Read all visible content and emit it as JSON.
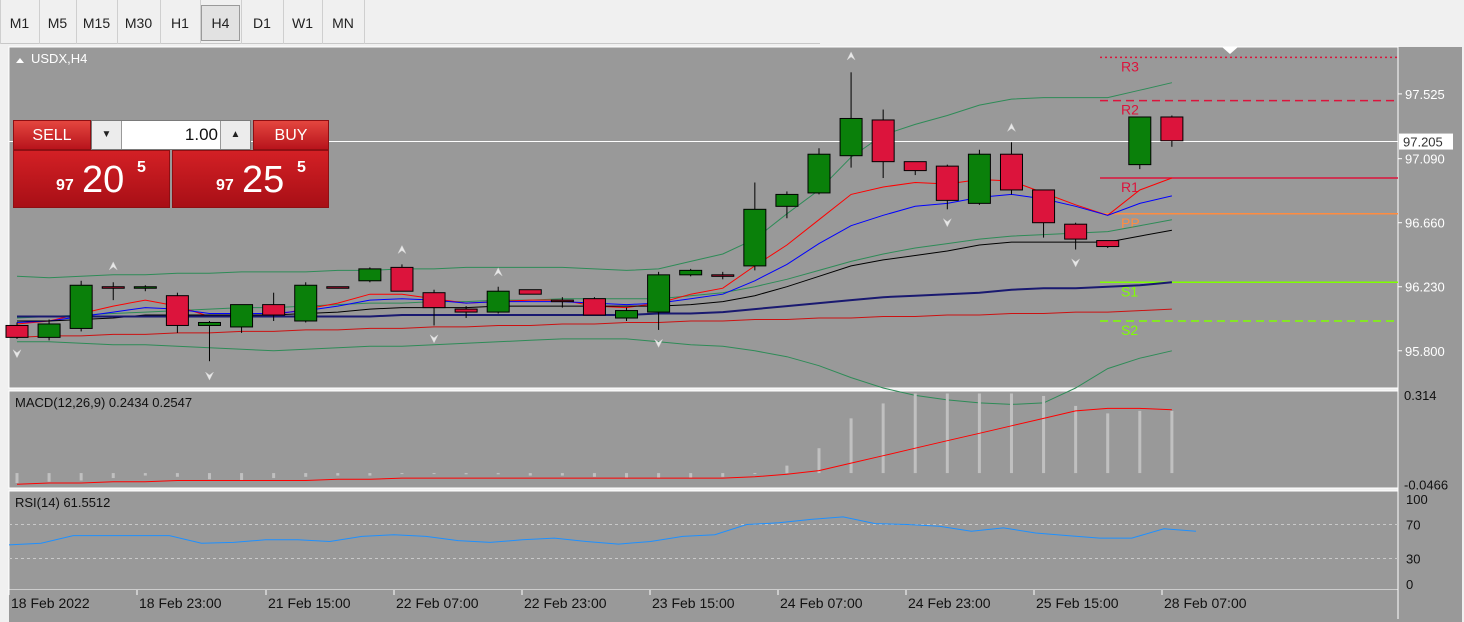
{
  "timeframes": [
    {
      "label": "M1",
      "active": false
    },
    {
      "label": "M5",
      "active": false
    },
    {
      "label": "M15",
      "active": false
    },
    {
      "label": "M30",
      "active": false
    },
    {
      "label": "H1",
      "active": false
    },
    {
      "label": "H4",
      "active": true
    },
    {
      "label": "D1",
      "active": false
    },
    {
      "label": "W1",
      "active": false
    },
    {
      "label": "MN",
      "active": false
    }
  ],
  "symbol_label": "USDX,H4",
  "trade_panel": {
    "sell_label": "SELL",
    "buy_label": "BUY",
    "lot_value": "1.00",
    "sell_price": {
      "prefix": "97",
      "big": "20",
      "sup": "5"
    },
    "buy_price": {
      "prefix": "97",
      "big": "25",
      "sup": "5"
    }
  },
  "colors": {
    "chart_bg": "#999999",
    "bull": "#0a800a",
    "bear": "#dc143c",
    "candle_outline": "#000000",
    "bollinger": "#2e8b57",
    "ma_red": "#ff0000",
    "ma_blue": "#0000ff",
    "ma_black": "#000000",
    "ma_navy": "#191970",
    "ma_long": "#cc1111",
    "rsi_line": "#1e90ff",
    "macd_hist": "#c0c0c0",
    "macd_signal": "#ff0000",
    "r_levels": "#dc143c",
    "pp": "#ff8c40",
    "s_levels": "#7fff00",
    "price_line": "#ffffff"
  },
  "chart_data": [
    {
      "type": "candlestick",
      "title": "USDX,H4",
      "ylim": [
        95.55,
        97.84
      ],
      "y_ticks": [
        "97.525",
        "97.090",
        "96.660",
        "96.230",
        "95.800"
      ],
      "current_price": "97.205",
      "x_labels": [
        "18 Feb 2022",
        "18 Feb 23:00",
        "21 Feb 15:00",
        "22 Feb 07:00",
        "22 Feb 23:00",
        "23 Feb 15:00",
        "24 Feb 07:00",
        "24 Feb 23:00",
        "25 Feb 15:00",
        "28 Feb 07:00"
      ],
      "ohlc": [
        [
          95.97,
          95.99,
          95.88,
          95.89
        ],
        [
          95.89,
          96.01,
          95.87,
          95.98
        ],
        [
          95.95,
          96.27,
          95.93,
          96.24
        ],
        [
          96.23,
          96.26,
          96.14,
          96.22
        ],
        [
          96.22,
          96.24,
          96.2,
          96.23
        ],
        [
          96.17,
          96.19,
          95.92,
          95.97
        ],
        [
          95.97,
          96.0,
          95.73,
          95.99
        ],
        [
          95.96,
          96.11,
          95.92,
          96.11
        ],
        [
          96.11,
          96.19,
          96.0,
          96.04
        ],
        [
          96.0,
          96.26,
          95.99,
          96.24
        ],
        [
          96.23,
          96.23,
          96.22,
          96.22
        ],
        [
          96.27,
          96.36,
          96.26,
          96.35
        ],
        [
          96.36,
          96.38,
          96.23,
          96.2
        ],
        [
          96.19,
          96.21,
          95.97,
          96.09
        ],
        [
          96.08,
          96.1,
          96.02,
          96.06
        ],
        [
          96.06,
          96.23,
          96.05,
          96.2
        ],
        [
          96.21,
          96.21,
          96.18,
          96.18
        ],
        [
          96.14,
          96.16,
          96.09,
          96.13
        ],
        [
          96.15,
          96.16,
          96.07,
          96.04
        ],
        [
          96.02,
          96.09,
          96.0,
          96.07
        ],
        [
          96.06,
          96.33,
          95.94,
          96.31
        ],
        [
          96.31,
          96.35,
          96.3,
          96.34
        ],
        [
          96.31,
          96.33,
          96.28,
          96.3
        ],
        [
          96.37,
          96.93,
          96.34,
          96.75
        ],
        [
          96.77,
          96.87,
          96.69,
          96.85
        ],
        [
          96.86,
          97.16,
          96.85,
          97.12
        ],
        [
          97.11,
          97.67,
          97.03,
          97.36
        ],
        [
          97.35,
          97.42,
          96.96,
          97.07
        ],
        [
          97.07,
          97.07,
          96.98,
          97.01
        ],
        [
          97.04,
          97.05,
          96.75,
          96.81
        ],
        [
          96.79,
          97.15,
          96.78,
          97.12
        ],
        [
          97.12,
          97.2,
          96.85,
          96.88
        ],
        [
          96.88,
          96.88,
          96.56,
          96.66
        ],
        [
          96.65,
          96.66,
          96.48,
          96.55
        ],
        [
          96.54,
          96.54,
          96.49,
          96.5
        ],
        [
          97.05,
          97.37,
          97.02,
          97.37
        ],
        [
          97.37,
          97.38,
          97.17,
          97.21
        ]
      ],
      "fractals": [
        {
          "i": 0,
          "dir": "down",
          "y": 95.78
        },
        {
          "i": 3,
          "dir": "up",
          "y": 96.37
        },
        {
          "i": 6,
          "dir": "down",
          "y": 95.63
        },
        {
          "i": 12,
          "dir": "up",
          "y": 96.48
        },
        {
          "i": 13,
          "dir": "down",
          "y": 95.88
        },
        {
          "i": 15,
          "dir": "up",
          "y": 96.33
        },
        {
          "i": 20,
          "dir": "down",
          "y": 95.85
        },
        {
          "i": 26,
          "dir": "up",
          "y": 97.78
        },
        {
          "i": 29,
          "dir": "down",
          "y": 96.66
        },
        {
          "i": 31,
          "dir": "up",
          "y": 97.3
        },
        {
          "i": 33,
          "dir": "down",
          "y": 96.39
        }
      ],
      "pivots": [
        {
          "label": "R3",
          "value": 97.77,
          "style": "dotted",
          "color_key": "r_levels"
        },
        {
          "label": "R2",
          "value": 97.48,
          "style": "dashed",
          "color_key": "r_levels"
        },
        {
          "label": "R1",
          "value": 96.96,
          "style": "solid",
          "color_key": "r_levels"
        },
        {
          "label": "PP",
          "value": 96.72,
          "style": "solid",
          "color_key": "pp"
        },
        {
          "label": "S1",
          "value": 96.26,
          "style": "solid",
          "color_key": "s_levels"
        },
        {
          "label": "S2",
          "value": 96.0,
          "style": "dashed",
          "color_key": "s_levels"
        }
      ],
      "indicators": [
        {
          "key": "bb_upper",
          "color_key": "bollinger",
          "width": 1,
          "values": [
            96.3,
            96.29,
            96.3,
            96.31,
            96.31,
            96.32,
            96.32,
            96.33,
            96.33,
            96.33,
            96.34,
            96.34,
            96.35,
            96.35,
            96.36,
            96.36,
            96.36,
            96.36,
            96.35,
            96.34,
            96.35,
            96.4,
            96.45,
            96.55,
            96.72,
            96.88,
            97.1,
            97.25,
            97.32,
            97.38,
            97.45,
            97.49,
            97.5,
            97.5,
            97.5,
            97.55,
            97.6
          ]
        },
        {
          "key": "bb_lower",
          "color_key": "bollinger",
          "width": 1,
          "values": [
            95.86,
            95.86,
            95.85,
            95.84,
            95.84,
            95.83,
            95.82,
            95.81,
            95.8,
            95.81,
            95.82,
            95.83,
            95.83,
            95.84,
            95.85,
            95.86,
            95.87,
            95.88,
            95.88,
            95.88,
            95.86,
            95.84,
            95.83,
            95.8,
            95.76,
            95.7,
            95.62,
            95.55,
            95.5,
            95.47,
            95.45,
            95.44,
            95.45,
            95.55,
            95.68,
            95.75,
            95.8
          ]
        },
        {
          "key": "bb_mid",
          "color_key": "bollinger",
          "width": 1,
          "values": [
            96.02,
            96.03,
            96.04,
            96.05,
            96.06,
            96.07,
            96.08,
            96.09,
            96.09,
            96.1,
            96.11,
            96.12,
            96.12,
            96.13,
            96.13,
            96.14,
            96.14,
            96.15,
            96.15,
            96.15,
            96.15,
            96.17,
            96.19,
            96.23,
            96.28,
            96.34,
            96.4,
            96.45,
            96.49,
            96.52,
            96.55,
            96.57,
            96.58,
            96.59,
            96.6,
            96.64,
            96.68
          ]
        },
        {
          "key": "ma_red",
          "color_key": "ma_red",
          "width": 1,
          "values": [
            95.98,
            96.0,
            96.05,
            96.1,
            96.14,
            96.1,
            96.03,
            96.03,
            96.04,
            96.08,
            96.12,
            96.18,
            96.18,
            96.15,
            96.12,
            96.13,
            96.14,
            96.14,
            96.1,
            96.09,
            96.12,
            96.18,
            96.22,
            96.37,
            96.51,
            96.68,
            96.85,
            96.9,
            96.93,
            96.92,
            96.95,
            96.94,
            96.86,
            96.78,
            96.71,
            96.88,
            96.96
          ]
        },
        {
          "key": "ma_blue",
          "color_key": "ma_blue",
          "width": 1,
          "values": [
            95.99,
            96.0,
            96.03,
            96.06,
            96.09,
            96.08,
            96.05,
            96.05,
            96.05,
            96.07,
            96.1,
            96.14,
            96.15,
            96.14,
            96.12,
            96.13,
            96.13,
            96.13,
            96.12,
            96.11,
            96.12,
            96.15,
            96.18,
            96.27,
            96.38,
            96.52,
            96.64,
            96.71,
            96.77,
            96.79,
            96.83,
            96.85,
            96.82,
            96.77,
            96.71,
            96.79,
            96.84
          ]
        },
        {
          "key": "ma_black",
          "color_key": "ma_black",
          "width": 1,
          "values": [
            96.0,
            96.0,
            96.01,
            96.02,
            96.04,
            96.04,
            96.04,
            96.04,
            96.04,
            96.05,
            96.06,
            96.08,
            96.09,
            96.09,
            96.09,
            96.1,
            96.1,
            96.1,
            96.1,
            96.1,
            96.1,
            96.11,
            96.13,
            96.17,
            96.23,
            96.3,
            96.37,
            96.41,
            96.44,
            96.47,
            96.51,
            96.53,
            96.53,
            96.53,
            96.53,
            96.57,
            96.61
          ]
        },
        {
          "key": "ma_navy",
          "color_key": "ma_navy",
          "width": 2,
          "values": [
            96.03,
            96.03,
            96.03,
            96.03,
            96.03,
            96.03,
            96.03,
            96.03,
            96.03,
            96.03,
            96.03,
            96.03,
            96.04,
            96.04,
            96.04,
            96.04,
            96.04,
            96.04,
            96.04,
            96.04,
            96.05,
            96.05,
            96.06,
            96.08,
            96.1,
            96.12,
            96.14,
            96.16,
            96.17,
            96.18,
            96.19,
            96.21,
            96.22,
            96.22,
            96.23,
            96.24,
            96.26
          ]
        },
        {
          "key": "ma_long",
          "color_key": "ma_long",
          "width": 1,
          "values": [
            95.89,
            95.9,
            95.9,
            95.91,
            95.91,
            95.92,
            95.92,
            95.93,
            95.93,
            95.94,
            95.94,
            95.95,
            95.95,
            95.96,
            95.96,
            95.97,
            95.97,
            95.98,
            95.98,
            95.99,
            95.99,
            96.0,
            96.0,
            96.01,
            96.01,
            96.02,
            96.02,
            96.03,
            96.03,
            96.04,
            96.04,
            96.05,
            96.05,
            96.06,
            96.06,
            96.07,
            96.08
          ]
        }
      ]
    },
    {
      "type": "bar",
      "title": "MACD(12,26,9) 0.2434 0.2547",
      "ylim": [
        -0.06,
        0.33
      ],
      "y_ticks": [
        "0.314",
        "-0.0466"
      ],
      "histogram": [
        -0.04,
        -0.035,
        -0.03,
        -0.02,
        -0.01,
        -0.015,
        -0.025,
        -0.03,
        -0.02,
        -0.015,
        -0.01,
        -0.01,
        0.0,
        0.0,
        -0.005,
        -0.005,
        -0.01,
        -0.01,
        -0.015,
        -0.02,
        -0.02,
        -0.02,
        -0.015,
        0.0,
        0.03,
        0.1,
        0.22,
        0.28,
        0.32,
        0.32,
        0.32,
        0.32,
        0.31,
        0.27,
        0.24,
        0.25,
        0.25
      ],
      "signal": [
        -0.045,
        -0.04,
        -0.04,
        -0.035,
        -0.035,
        -0.03,
        -0.03,
        -0.03,
        -0.03,
        -0.03,
        -0.025,
        -0.025,
        -0.02,
        -0.02,
        -0.02,
        -0.02,
        -0.02,
        -0.02,
        -0.02,
        -0.02,
        -0.02,
        -0.02,
        -0.02,
        -0.015,
        -0.005,
        0.01,
        0.04,
        0.07,
        0.1,
        0.13,
        0.16,
        0.19,
        0.22,
        0.25,
        0.26,
        0.26,
        0.255
      ]
    },
    {
      "type": "line",
      "title": "RSI(14) 61.5512",
      "ylim": [
        0,
        100
      ],
      "y_ticks": [
        "100",
        "70",
        "30",
        "0"
      ],
      "levels": [
        70,
        30
      ],
      "values": [
        46,
        48,
        57,
        57,
        57,
        57,
        48,
        49,
        52,
        52,
        50,
        56,
        58,
        56,
        51,
        49,
        52,
        54,
        50,
        47,
        50,
        56,
        58,
        70,
        72,
        76,
        79,
        71,
        70,
        68,
        62,
        66,
        60,
        57,
        54,
        54,
        65,
        62
      ]
    }
  ]
}
